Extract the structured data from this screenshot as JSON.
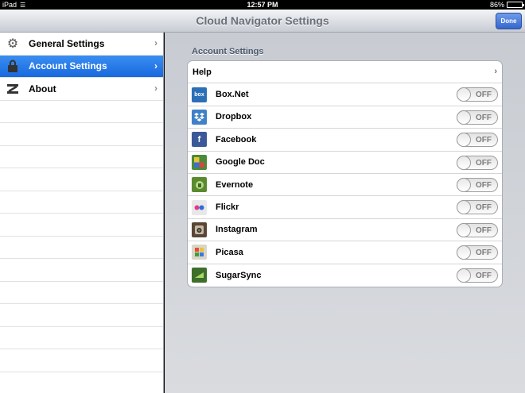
{
  "status_bar": {
    "device": "iPad",
    "time": "12:57 PM",
    "battery_text": "86%",
    "battery_level": 0.86
  },
  "navbar": {
    "title": "Cloud Navigator Settings",
    "done_label": "Done"
  },
  "sidebar": {
    "items": [
      {
        "label": "General Settings",
        "icon": "gear-icon",
        "selected": false
      },
      {
        "label": "Account Settings",
        "icon": "lock-icon",
        "selected": true
      },
      {
        "label": "About",
        "icon": "about-icon",
        "selected": false
      }
    ]
  },
  "main": {
    "section_title": "Account Settings",
    "help_label": "Help",
    "services": [
      {
        "name": "Box.Net",
        "icon": "box-icon",
        "color": "#2b6fb6",
        "toggle": "OFF"
      },
      {
        "name": "Dropbox",
        "icon": "dropbox-icon",
        "color": "#3f80c8",
        "toggle": "OFF"
      },
      {
        "name": "Facebook",
        "icon": "facebook-icon",
        "color": "#3b5998",
        "toggle": "OFF"
      },
      {
        "name": "Google Doc",
        "icon": "google-doc-icon",
        "color": "#4a8a38",
        "toggle": "OFF"
      },
      {
        "name": "Evernote",
        "icon": "evernote-icon",
        "color": "#5a8a2e",
        "toggle": "OFF"
      },
      {
        "name": "Flickr",
        "icon": "flickr-icon",
        "color": "#e8e8e8",
        "toggle": "OFF"
      },
      {
        "name": "Instagram",
        "icon": "instagram-icon",
        "color": "#5a4638",
        "toggle": "OFF"
      },
      {
        "name": "Picasa",
        "icon": "picasa-icon",
        "color": "#d9d6c8",
        "toggle": "OFF"
      },
      {
        "name": "SugarSync",
        "icon": "sugarsync-icon",
        "color": "#3d6e2a",
        "toggle": "OFF"
      }
    ]
  }
}
